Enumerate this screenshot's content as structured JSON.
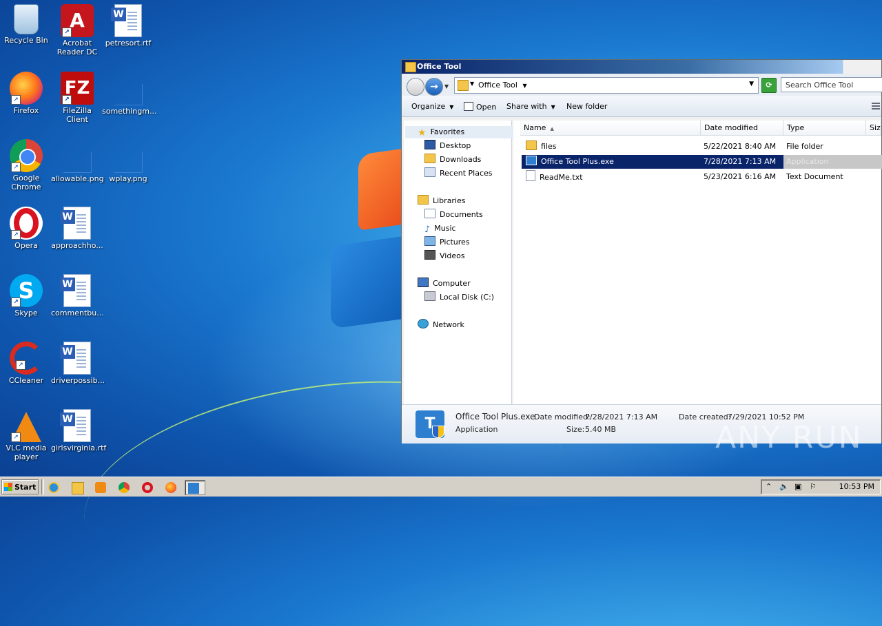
{
  "desktop": {
    "icons": [
      {
        "label": "Recycle Bin",
        "icon": "recycle-bin-icon"
      },
      {
        "label": "Acrobat Reader DC",
        "icon": "acrobat-icon"
      },
      {
        "label": "petresort.rtf",
        "icon": "word-doc-icon"
      },
      {
        "label": "Firefox",
        "icon": "firefox-icon"
      },
      {
        "label": "FileZilla Client",
        "icon": "filezilla-icon"
      },
      {
        "label": "somethingm...",
        "icon": "blank-file-icon"
      },
      {
        "label": "Google Chrome",
        "icon": "chrome-icon"
      },
      {
        "label": "allowable.png",
        "icon": "image-file-icon"
      },
      {
        "label": "wplay.png",
        "icon": "image-file-icon"
      },
      {
        "label": "Opera",
        "icon": "opera-icon"
      },
      {
        "label": "approachho...",
        "icon": "word-doc-icon"
      },
      {
        "label": "Skype",
        "icon": "skype-icon"
      },
      {
        "label": "commentbu...",
        "icon": "word-doc-icon"
      },
      {
        "label": "CCleaner",
        "icon": "ccleaner-icon"
      },
      {
        "label": "driverpossib...",
        "icon": "word-doc-icon"
      },
      {
        "label": "VLC media player",
        "icon": "vlc-icon"
      },
      {
        "label": "girlsvirginia.rtf",
        "icon": "word-doc-icon"
      }
    ]
  },
  "window": {
    "title": "Office Tool",
    "address": {
      "crumb": "Office Tool"
    },
    "search_placeholder": "Search Office Tool",
    "toolbar": {
      "organize": "Organize",
      "open": "Open",
      "share_with": "Share with",
      "new_folder": "New folder"
    },
    "nav": {
      "favorites": "Favorites",
      "desktop": "Desktop",
      "downloads": "Downloads",
      "recent_places": "Recent Places",
      "libraries": "Libraries",
      "documents": "Documents",
      "music": "Music",
      "pictures": "Pictures",
      "videos": "Videos",
      "computer": "Computer",
      "local_disk": "Local Disk (C:)",
      "network": "Network"
    },
    "columns": {
      "name": "Name",
      "date_modified": "Date modified",
      "type": "Type",
      "size": "Size"
    },
    "files": [
      {
        "name": "files",
        "date": "5/22/2021 8:40 AM",
        "type": "File folder",
        "icon": "folder-icon"
      },
      {
        "name": "Office Tool Plus.exe",
        "date": "7/28/2021 7:13 AM",
        "type": "Application",
        "icon": "exe-icon",
        "selected": true
      },
      {
        "name": "ReadMe.txt",
        "date": "5/23/2021 6:16 AM",
        "type": "Text Document",
        "icon": "text-file-icon"
      }
    ],
    "details": {
      "name": "Office Tool Plus.exe",
      "type": "Application",
      "date_modified_label": "Date modified:",
      "date_modified": "7/28/2021 7:13 AM",
      "date_created_label": "Date created:",
      "date_created": "7/29/2021 10:52 PM",
      "size_label": "Size:",
      "size": "5.40 MB"
    }
  },
  "taskbar": {
    "start_label": "Start",
    "clock": "10:53 PM"
  },
  "watermark": "ANY RUN"
}
